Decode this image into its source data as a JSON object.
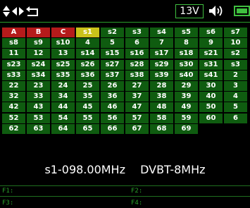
{
  "status": {
    "voltage": "13V",
    "icons": [
      "up-down-arrows-icon",
      "left-arrow-icon",
      "right-arrow-icon",
      "return-icon",
      "speaker-icon",
      "battery-icon"
    ],
    "accent_color": "#2aa02a"
  },
  "channel_grid": {
    "rows": [
      [
        "A",
        "B",
        "C",
        "s1",
        "s2",
        "s3",
        "s4",
        "s5",
        "s6",
        "s7"
      ],
      [
        "s8",
        "s9",
        "s10",
        "4",
        "5",
        "6",
        "7",
        "8",
        "9",
        "10"
      ],
      [
        "11",
        "12",
        "13",
        "s14",
        "s15",
        "s16",
        "s17",
        "s18",
        "s21",
        "s2"
      ],
      [
        "s23",
        "s24",
        "s25",
        "s26",
        "s27",
        "s28",
        "s29",
        "s30",
        "s31",
        "s3"
      ],
      [
        "s33",
        "s34",
        "s35",
        "s36",
        "s37",
        "s38",
        "s39",
        "s40",
        "s41",
        "2"
      ],
      [
        "22",
        "23",
        "24",
        "25",
        "26",
        "27",
        "28",
        "29",
        "30",
        "3"
      ],
      [
        "32",
        "33",
        "34",
        "35",
        "36",
        "37",
        "38",
        "39",
        "40",
        "4"
      ],
      [
        "42",
        "43",
        "44",
        "45",
        "46",
        "47",
        "48",
        "49",
        "50",
        "5"
      ],
      [
        "52",
        "53",
        "54",
        "55",
        "56",
        "57",
        "58",
        "59",
        "60",
        "6"
      ],
      [
        "62",
        "63",
        "64",
        "65",
        "66",
        "67",
        "68",
        "69"
      ]
    ],
    "highlighted_red": [
      "A",
      "B",
      "C"
    ],
    "selected": "s1",
    "colors": {
      "cell": "#0f5c10",
      "red": "#b51b1b",
      "selected": "#c9c21a"
    }
  },
  "readout": {
    "channel_frequency": "s1-098.00MHz",
    "mode": "DVBT-8MHz"
  },
  "function_keys": {
    "f1": "F1:",
    "f2": "F2:",
    "f3": "F3:",
    "f4": "F4:"
  }
}
